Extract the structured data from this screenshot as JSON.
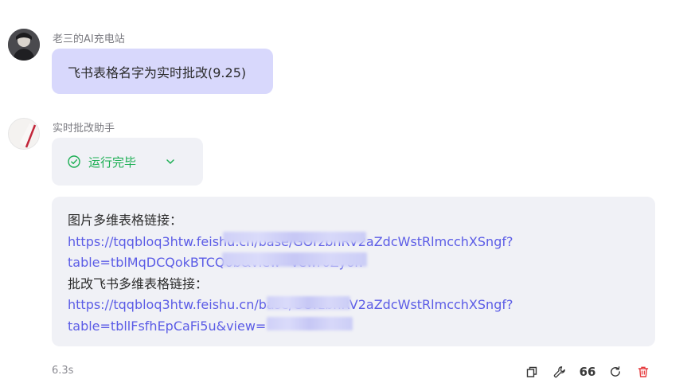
{
  "messages": {
    "user": {
      "name": "老三的AI充电站",
      "text": "飞书表格名字为实时批改(9.25)"
    },
    "bot": {
      "name": "实时批改助手",
      "run_status": "运行完毕",
      "lines": [
        {
          "kind": "plain",
          "text": "图片多维表格链接："
        },
        {
          "kind": "link",
          "text": "https://tqqbloq3htw.feishu.cn/base/GOrzbnRV2aZdcWstRlmcchXSngf?"
        },
        {
          "kind": "link",
          "text": "table=tblMqDCQokBTCQ6b&view=vewr6Zy6n"
        },
        {
          "kind": "plain",
          "text": "批改飞书多维表格链接："
        },
        {
          "kind": "link",
          "text": "https://tqqbloq3htw.feishu.cn/base/GOrzbnRV2aZdcWstRlmcchXSngf?"
        },
        {
          "kind": "link",
          "text": "table=tbllFsfhEpCaFi5u&view="
        }
      ],
      "elapsed": "6.3s"
    }
  },
  "actions": [
    {
      "name": "copy-icon",
      "text": ""
    },
    {
      "name": "wrench-icon",
      "text": ""
    },
    {
      "name": "quote-icon",
      "text": "66"
    },
    {
      "name": "refresh-icon",
      "text": ""
    },
    {
      "name": "delete-icon",
      "text": ""
    }
  ],
  "colors": {
    "user_bubble": "#d8d8fc",
    "bot_bubble": "#f0f1f6",
    "link": "#5b5ce6",
    "success": "#1aae52",
    "danger": "#e5383b"
  }
}
